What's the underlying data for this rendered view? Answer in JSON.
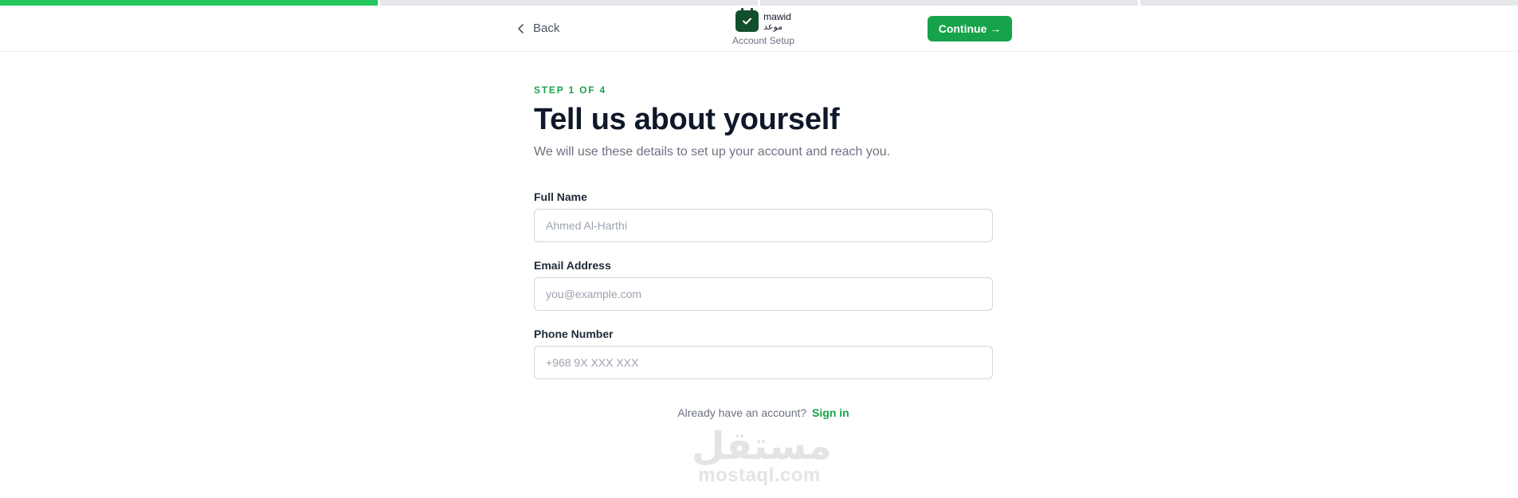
{
  "progress": {
    "total_steps": 4,
    "current_step": 1
  },
  "header": {
    "back_label": "Back",
    "brand_name_en": "mawid",
    "brand_name_ar": "موعد",
    "brand_subtitle": "Account Setup",
    "continue_label": "Continue →"
  },
  "main": {
    "step_label": "STEP 1 OF 4",
    "title": "Tell us about yourself",
    "subtitle": "We will use these details to set up your account and reach you.",
    "fields": [
      {
        "label": "Full Name",
        "placeholder": "Ahmed Al-Harthi",
        "value": ""
      },
      {
        "label": "Email Address",
        "placeholder": "you@example.com",
        "value": ""
      },
      {
        "label": "Phone Number",
        "placeholder": "+968 9X XXX XXX",
        "value": ""
      }
    ],
    "signin_prompt": "Already have an account?",
    "signin_link": "Sign in"
  },
  "watermark": {
    "arabic": "مستقل",
    "latin": "mostaql.com"
  },
  "colors": {
    "accent": "#16a34a",
    "progress": "#22c55e",
    "logo": "#134e2c"
  },
  "icons": {
    "back": "chevron-left-icon",
    "logo": "calendar-check-icon"
  }
}
